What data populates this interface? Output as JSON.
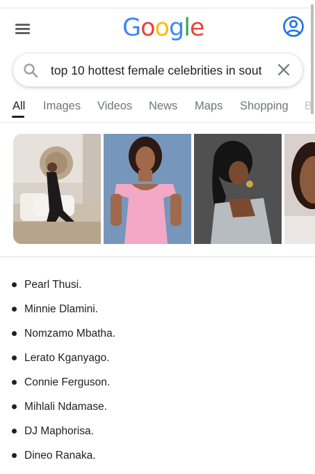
{
  "header": {
    "logo": {
      "g1": "G",
      "o1": "o",
      "o2": "o",
      "g2": "g",
      "l": "l",
      "e": "e"
    },
    "menu_icon": "hamburger-menu-icon",
    "account_icon": "account-circle-icon"
  },
  "search": {
    "query": "top 10 hottest female celebrities in sout",
    "search_icon": "search-icon",
    "clear_icon": "close-icon"
  },
  "tabs": [
    {
      "label": "All",
      "active": true
    },
    {
      "label": "Images",
      "active": false
    },
    {
      "label": "Videos",
      "active": false
    },
    {
      "label": "News",
      "active": false
    },
    {
      "label": "Maps",
      "active": false
    },
    {
      "label": "Shopping",
      "active": false
    },
    {
      "label": "B",
      "active": false
    }
  ],
  "images": [
    {
      "alt": "photo-1"
    },
    {
      "alt": "photo-2"
    },
    {
      "alt": "photo-3"
    },
    {
      "alt": "photo-4"
    }
  ],
  "results": [
    "Pearl Thusi.",
    "Minnie Dlamini.",
    "Nomzamo Mbatha.",
    "Lerato Kganyago.",
    "Connie Ferguson.",
    "Mihlali Ndamase.",
    "DJ Maphorisa.",
    "Dineo Ranaka."
  ]
}
